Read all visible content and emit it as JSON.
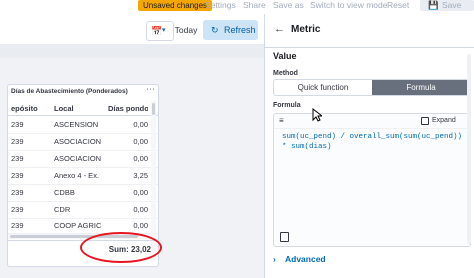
{
  "topbar": {
    "unsaved_label": "Unsaved changes",
    "settings_label": "Settings",
    "share_label": "Share",
    "save_as_label": "Save as",
    "switch_view_label": "Switch to view mode",
    "reset_label": "Reset",
    "save_label": "Save",
    "unsaved_color": "#f5a700"
  },
  "querybar": {
    "date_icon": "calendar-icon",
    "today_label": "Today",
    "refresh_label": "Refresh",
    "refresh_icon": "refresh-icon"
  },
  "table_panel": {
    "title": "Días de Abastecimiento (Ponderados)",
    "columns": [
      "epósito",
      "Local",
      "Días pondo"
    ],
    "rows": [
      [
        "239",
        "ASCENSION",
        "0,00"
      ],
      [
        "239",
        "ASOCIACION",
        "0,00"
      ],
      [
        "239",
        "ASOCIACION",
        "0,00"
      ],
      [
        "239",
        "Anexo 4 - Ex.",
        "3,25"
      ],
      [
        "239",
        "CDBB",
        "0,00"
      ],
      [
        "239",
        "CDR",
        "0,00"
      ],
      [
        "239",
        "COOP AGRIC",
        "0,00"
      ]
    ],
    "sum_label": "Sum: 23,02",
    "highlight_color": "#e5161f"
  },
  "flyout": {
    "back_icon": "arrow-left-icon",
    "title": "Metric",
    "section_title": "Value",
    "method_label": "Method",
    "method_options": [
      "Quick function",
      "Formula"
    ],
    "method_selected": "Formula",
    "formula_label": "Formula",
    "expand_label": "Expand",
    "formula_lines": [
      "sum(uc_pend) / overall_sum(sum(uc_pend))",
      "* sum(dias)"
    ],
    "advanced_label": "Advanced"
  }
}
